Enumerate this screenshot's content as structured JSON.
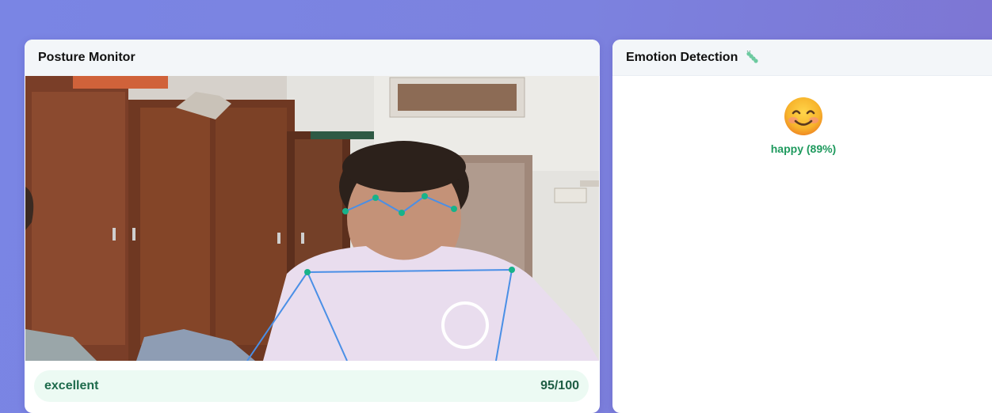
{
  "posture": {
    "title": "Posture Monitor",
    "status": "excellent",
    "score": "95/100"
  },
  "emotion": {
    "title": "Emotion Detection",
    "emotion_name": "happy",
    "confidence": "(89%)",
    "emoji_icon": "smiling-face-icon",
    "header_icon": "caterpillar-icon"
  },
  "colors": {
    "background_start": "#7a85e4",
    "background_end": "#7d74d2",
    "status_bg": "#ecfaf3",
    "status_text": "#1e6b4c",
    "emotion_text": "#1f9a5e",
    "landmark_line": "#4a8fe6",
    "landmark_point": "#17b38a"
  }
}
